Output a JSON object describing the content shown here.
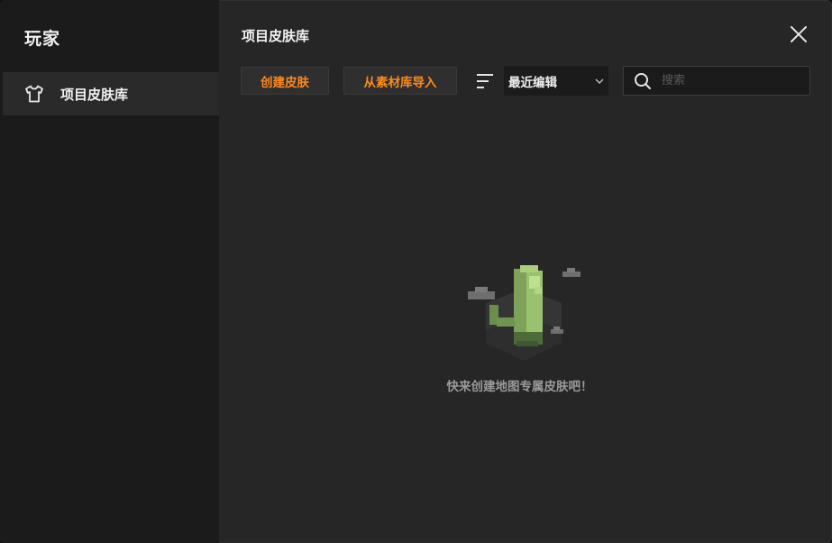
{
  "sidebar": {
    "title": "玩家",
    "items": [
      {
        "label": "项目皮肤库",
        "icon": "tshirt-icon"
      }
    ]
  },
  "main": {
    "title": "项目皮肤库",
    "toolbar": {
      "create_label": "创建皮肤",
      "import_label": "从素材库导入",
      "sort_icon": "sort-icon",
      "sort_value": "最近编辑",
      "search_placeholder": "搜索"
    },
    "empty_state": {
      "message": "快来创建地图专属皮肤吧！",
      "illustration": "cactus-illustration"
    }
  },
  "colors": {
    "accent": "#ff8a1c",
    "window_bg": "#262626",
    "sidebar_bg": "#1b1b1b",
    "selected_item_bg": "#2a2a2a"
  }
}
